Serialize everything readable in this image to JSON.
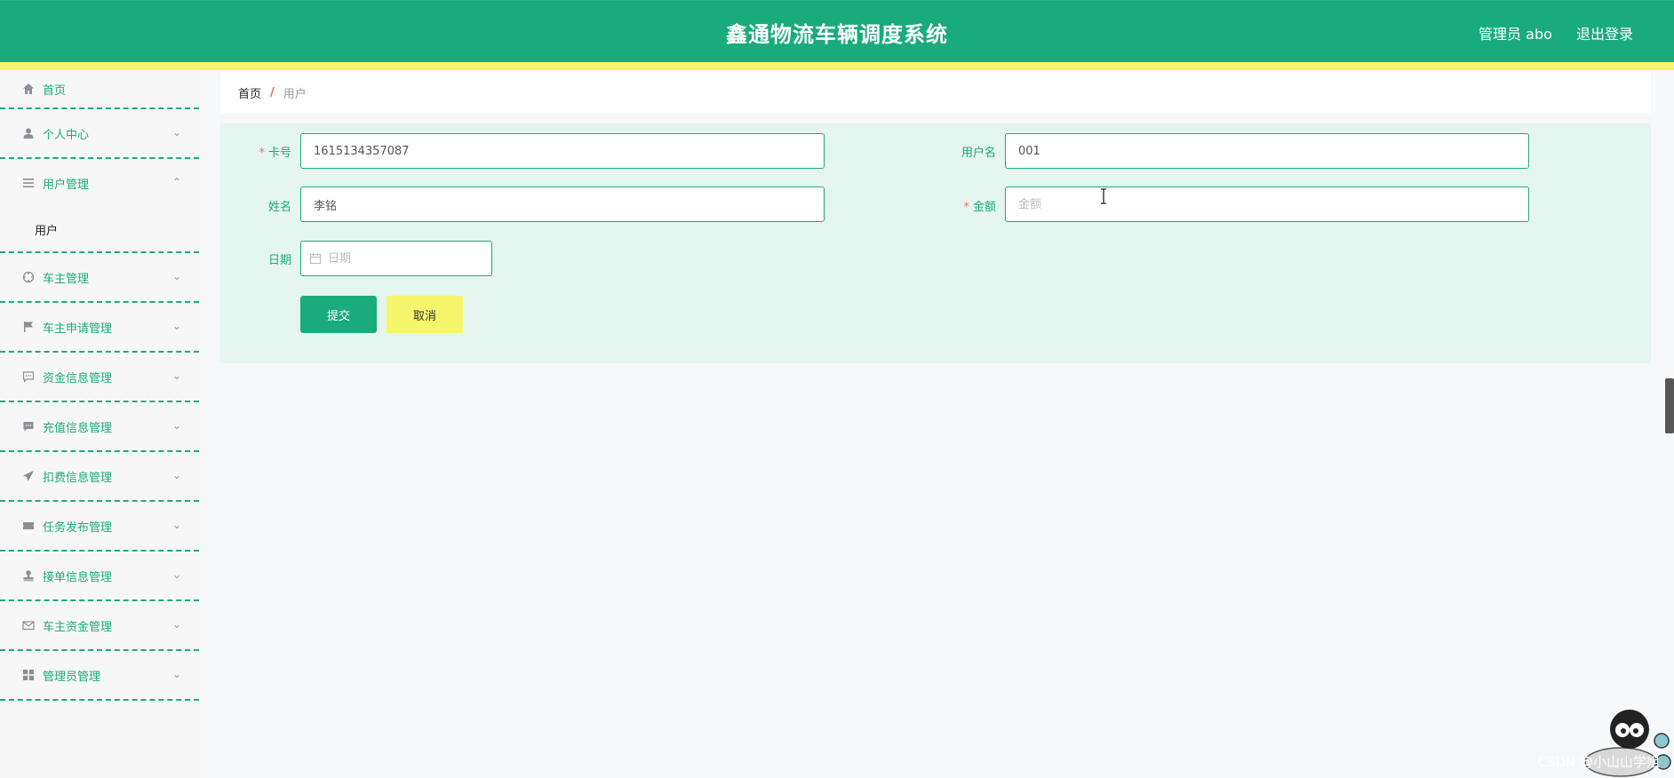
{
  "header": {
    "title": "鑫通物流车辆调度系统",
    "user_label": "管理员 abo",
    "logout_label": "退出登录",
    "accent_color": "#1aab7c",
    "strip_color": "#f7f56b"
  },
  "sidebar": {
    "items": [
      {
        "label": "首页",
        "icon": "home-icon"
      },
      {
        "label": "个人中心",
        "icon": "user-icon"
      },
      {
        "label": "用户管理",
        "icon": "menu-icon",
        "expanded": true,
        "children": [
          "用户"
        ]
      },
      {
        "label": "车主管理",
        "icon": "compass-icon"
      },
      {
        "label": "车主申请管理",
        "icon": "flag-icon"
      },
      {
        "label": "资金信息管理",
        "icon": "chat-icon"
      },
      {
        "label": "充值信息管理",
        "icon": "message-icon"
      },
      {
        "label": "扣费信息管理",
        "icon": "send-icon"
      },
      {
        "label": "任务发布管理",
        "icon": "ticket-icon"
      },
      {
        "label": "接单信息管理",
        "icon": "stamp-icon"
      },
      {
        "label": "车主资金管理",
        "icon": "mail-icon"
      },
      {
        "label": "管理员管理",
        "icon": "grid-icon"
      }
    ]
  },
  "breadcrumb": {
    "home": "首页",
    "separator": "/",
    "current": "用户"
  },
  "form": {
    "card_no": {
      "label": "卡号",
      "required": true,
      "value": "1615134357087"
    },
    "username": {
      "label": "用户名",
      "required": false,
      "value": "001"
    },
    "name": {
      "label": "姓名",
      "required": false,
      "value": "李铭"
    },
    "amount": {
      "label": "金额",
      "required": true,
      "value": "",
      "placeholder": "金额"
    },
    "date": {
      "label": "日期",
      "value": "",
      "placeholder": "日期"
    },
    "submit_label": "提交",
    "cancel_label": "取消"
  },
  "watermark": "CSDN @小山山学姐"
}
